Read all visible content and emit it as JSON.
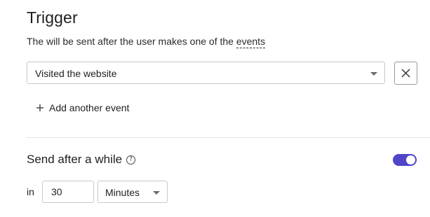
{
  "trigger": {
    "title": "Trigger",
    "description_prefix": "The will be sent after the user makes one of the ",
    "description_link": "events",
    "event_select_value": "Visited the website",
    "add_event_label": "Add another event"
  },
  "delay": {
    "title": "Send after a while",
    "help_icon": "?",
    "enabled": true,
    "in_label": "in",
    "amount": "30",
    "unit": "Minutes"
  },
  "colors": {
    "toggle_on": "#4f46c8",
    "border": "#c9c9c9",
    "text": "#1f1f1f"
  }
}
